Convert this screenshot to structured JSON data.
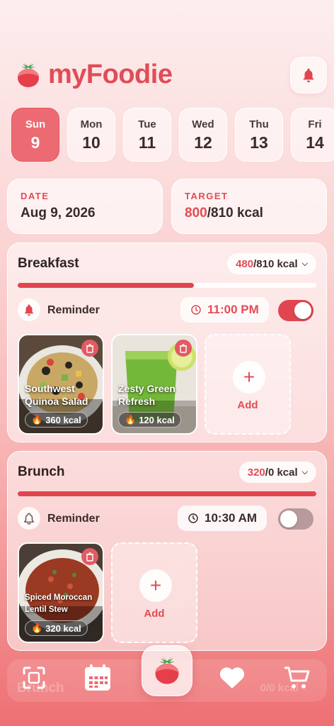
{
  "app": {
    "title": "myFoodie"
  },
  "days": [
    {
      "name": "Sun",
      "date": "9",
      "active": true
    },
    {
      "name": "Mon",
      "date": "10"
    },
    {
      "name": "Tue",
      "date": "11"
    },
    {
      "name": "Wed",
      "date": "12"
    },
    {
      "name": "Thu",
      "date": "13"
    },
    {
      "name": "Fri",
      "date": "14"
    }
  ],
  "date_card": {
    "label": "DATE",
    "value": "Aug 9, 2026"
  },
  "target_card": {
    "label": "TARGET",
    "consumed": "800",
    "total": "/810 kcal"
  },
  "meals": [
    {
      "title": "Breakfast",
      "consumed": "480",
      "target": "/810 kcal",
      "progress": 0.59,
      "reminder_label": "Reminder",
      "reminder_time": "11:00 PM",
      "reminder_on": true,
      "foods": [
        {
          "name": "Southwest Quinoa Salad",
          "kcal": "360 kcal"
        },
        {
          "name": "Zesty Green Refresh",
          "kcal": "120 kcal"
        }
      ],
      "add_label": "Add"
    },
    {
      "title": "Brunch",
      "consumed": "320",
      "target": "/0 kcal",
      "progress": 1.0,
      "reminder_label": "Reminder",
      "reminder_time": "10:30 AM",
      "reminder_on": false,
      "foods": [
        {
          "name": "Spiced Moroccan Lentil Stew",
          "kcal": "320 kcal"
        }
      ],
      "add_label": "Add"
    }
  ],
  "ghost_meal": {
    "title": "Brunch",
    "kcal": "0/0 kcal"
  },
  "nav": {
    "items": [
      "scan-icon",
      "calendar-icon",
      "strawberry-icon",
      "heart-icon",
      "cart-icon"
    ]
  },
  "colors": {
    "accent": "#e14c57",
    "active_day": "#ec6b72"
  }
}
